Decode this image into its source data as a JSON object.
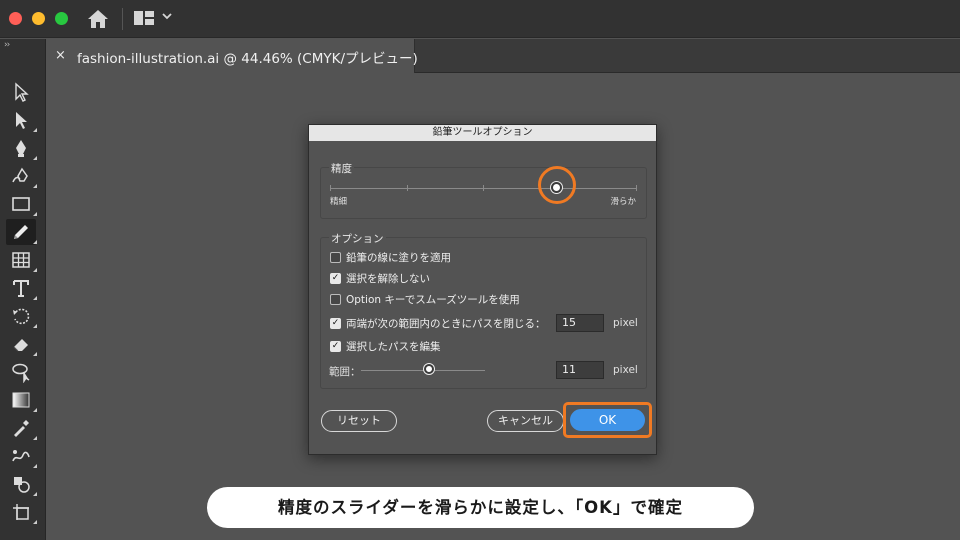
{
  "app": {
    "document_tab": {
      "close_glyph": "×",
      "title": "fashion-illustration.ai @ 44.46% (CMYK/プレビュー)"
    },
    "toolbar_collapse_glyph": "››",
    "tools": [
      {
        "name": "selection-tool-icon"
      },
      {
        "name": "direct-selection-tool-icon"
      },
      {
        "name": "pen-tool-icon"
      },
      {
        "name": "curvature-tool-icon"
      },
      {
        "name": "rectangle-tool-icon"
      },
      {
        "name": "pencil-tool-icon",
        "active": true
      },
      {
        "name": "grid-tool-icon"
      },
      {
        "name": "type-tool-icon"
      },
      {
        "name": "rotate-tool-icon"
      },
      {
        "name": "eraser-tool-icon"
      },
      {
        "name": "lasso-tool-icon"
      },
      {
        "name": "gradient-tool-icon"
      },
      {
        "name": "eyedropper-tool-icon"
      },
      {
        "name": "blend-tool-icon"
      },
      {
        "name": "shape-builder-tool-icon"
      },
      {
        "name": "artboard-tool-icon"
      }
    ]
  },
  "dialog": {
    "title": "鉛筆ツールオプション",
    "fidelity": {
      "label": "精度",
      "left_label": "精細",
      "right_label": "滑らか",
      "value_fraction": 0.74
    },
    "options": {
      "label": "オプション",
      "checkboxes": [
        {
          "label": "鉛筆の線に塗りを適用",
          "checked": false
        },
        {
          "label": "選択を解除しない",
          "checked": true
        },
        {
          "label": "Option キーでスムーズツールを使用",
          "checked": false
        },
        {
          "label": "両端が次の範囲内のときにパスを閉じる：",
          "checked": true
        },
        {
          "label": "選択したパスを編集",
          "checked": true
        }
      ],
      "close_paths_value": "15",
      "close_paths_unit": "pixel",
      "range_label": "範囲：",
      "range_value": "11",
      "range_unit": "pixel",
      "range_fraction": 0.55
    },
    "buttons": {
      "reset": "リセット",
      "cancel": "キャンセル",
      "ok": "OK"
    }
  },
  "caption": "精度のスライダーを滑らかに設定し、「OK」で確定",
  "colors": {
    "accent_blue": "#3e93e8",
    "highlight_orange": "#f07a23"
  }
}
